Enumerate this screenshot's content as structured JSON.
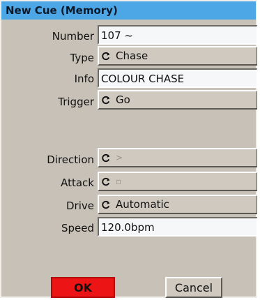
{
  "window": {
    "title": "New Cue (Memory)"
  },
  "fields": {
    "number": {
      "label": "Number",
      "value": "107 ~"
    },
    "type": {
      "label": "Type",
      "value": "Chase"
    },
    "info": {
      "label": "Info",
      "value": "COLOUR CHASE"
    },
    "trigger": {
      "label": "Trigger",
      "value": "Go"
    },
    "direction": {
      "label": "Direction",
      "value": ">"
    },
    "attack": {
      "label": "Attack",
      "value": "▫"
    },
    "drive": {
      "label": "Drive",
      "value": "Automatic"
    },
    "speed": {
      "label": "Speed",
      "value": "120.0bpm"
    }
  },
  "buttons": {
    "ok": "OK",
    "cancel": "Cancel"
  },
  "colors": {
    "title_bar": "#4da7e6",
    "ok_button": "#ec1414",
    "dialog_bg": "#c8c1b7"
  },
  "icons": {
    "select_indicator": "cycle-icon"
  }
}
